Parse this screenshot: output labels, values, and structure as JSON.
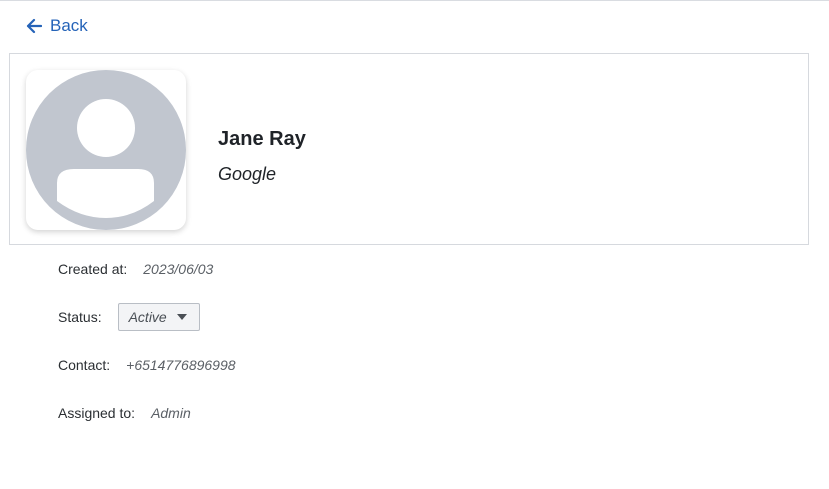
{
  "nav": {
    "back_label": "Back",
    "back_icon": "arrow-left-icon",
    "accent_color": "#2563b8"
  },
  "profile": {
    "name": "Jane Ray",
    "company": "Google",
    "avatar_icon": "user-placeholder-icon",
    "avatar_color": "#c1c6cf"
  },
  "details": {
    "created_label": "Created at:",
    "created_value": "2023/06/03",
    "status_label": "Status:",
    "status_value": "Active",
    "contact_label": "Contact:",
    "contact_value": "+6514776896998",
    "assigned_label": "Assigned to:",
    "assigned_value": "Admin"
  }
}
